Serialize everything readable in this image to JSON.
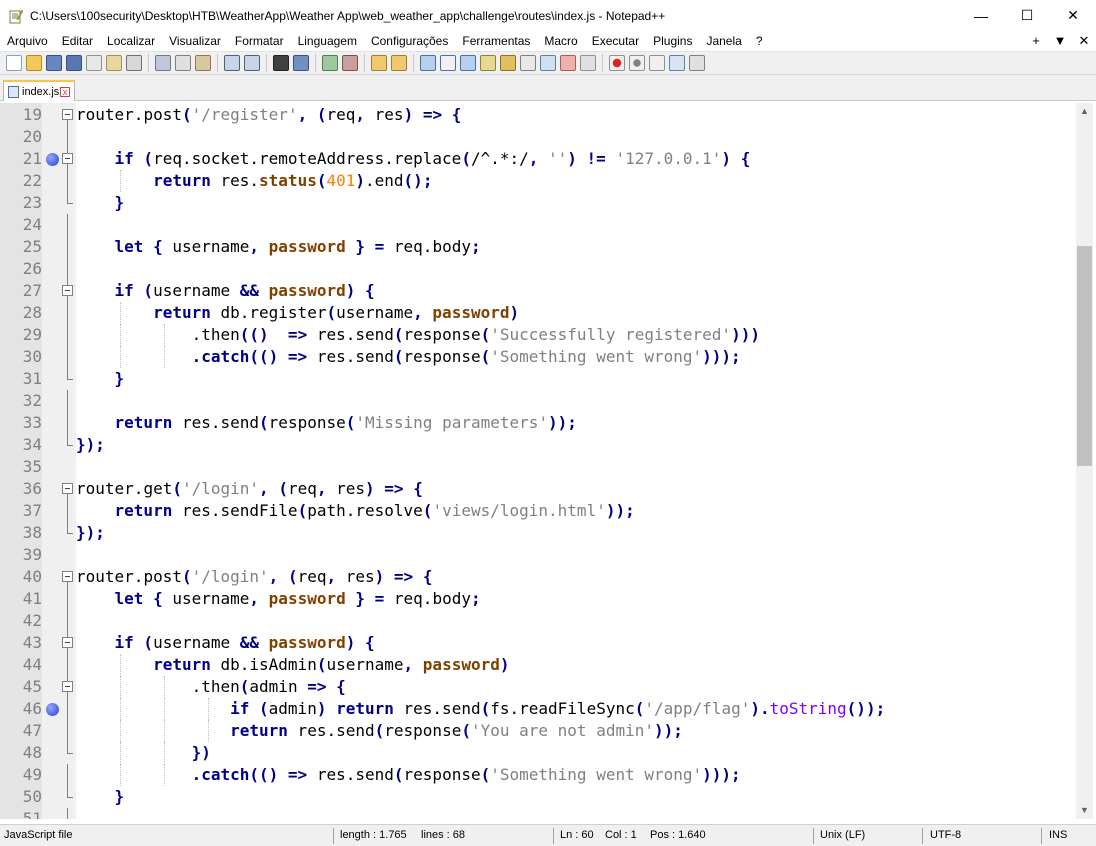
{
  "window": {
    "title": "C:\\Users\\100security\\Desktop\\HTB\\WeatherApp\\Weather App\\web_weather_app\\challenge\\routes\\index.js - Notepad++",
    "minimize_glyph": "—",
    "maximize_glyph": "☐",
    "close_glyph": "✕"
  },
  "menu": {
    "items": [
      "Arquivo",
      "Editar",
      "Localizar",
      "Visualizar",
      "Formatar",
      "Linguagem",
      "Configurações",
      "Ferramentas",
      "Macro",
      "Executar",
      "Plugins",
      "Janela",
      "?"
    ],
    "right": [
      "+",
      "▼",
      "✕"
    ]
  },
  "tab": {
    "label": "index.js"
  },
  "editor": {
    "lines": [
      {
        "n": "19",
        "fold": "start",
        "bookmark": false,
        "guides": [],
        "tokens": [
          [
            "txt",
            "router."
          ],
          [
            "txt",
            "post"
          ],
          [
            "op",
            "("
          ],
          [
            "str",
            "'/register'"
          ],
          [
            "op",
            ", ("
          ],
          [
            "txt",
            "req"
          ],
          [
            "op",
            ", "
          ],
          [
            "txt",
            "res"
          ],
          [
            "op",
            ") => {"
          ]
        ]
      },
      {
        "n": "20",
        "fold": "line",
        "bookmark": false,
        "guides": [],
        "tokens": []
      },
      {
        "n": "21",
        "fold": "start",
        "bookmark": true,
        "guides": [],
        "tokens": [
          [
            "txt",
            "    "
          ],
          [
            "kw",
            "if"
          ],
          [
            "op",
            " ("
          ],
          [
            "txt",
            "req.socket.remoteAddress.replace"
          ],
          [
            "op",
            "("
          ],
          [
            "txt",
            "/^.*:/"
          ],
          [
            "op",
            ", "
          ],
          [
            "str",
            "''"
          ],
          [
            "op",
            ") != "
          ],
          [
            "str",
            "'127.0.0.1'"
          ],
          [
            "op",
            ") {"
          ]
        ]
      },
      {
        "n": "22",
        "fold": "line",
        "bookmark": false,
        "guides": [
          1
        ],
        "tokens": [
          [
            "txt",
            "        "
          ],
          [
            "kw",
            "return"
          ],
          [
            "txt",
            " res."
          ],
          [
            "fn",
            "status"
          ],
          [
            "op",
            "("
          ],
          [
            "num",
            "401"
          ],
          [
            "op",
            ")"
          ],
          [
            "txt",
            ".end"
          ],
          [
            "op",
            "();"
          ]
        ]
      },
      {
        "n": "23",
        "fold": "end",
        "bookmark": false,
        "guides": [],
        "tokens": [
          [
            "txt",
            "    "
          ],
          [
            "op",
            "}"
          ]
        ]
      },
      {
        "n": "24",
        "fold": "line",
        "bookmark": false,
        "guides": [],
        "tokens": []
      },
      {
        "n": "25",
        "fold": "line",
        "bookmark": false,
        "guides": [],
        "tokens": [
          [
            "txt",
            "    "
          ],
          [
            "kw",
            "let"
          ],
          [
            "op",
            " { "
          ],
          [
            "txt",
            "username"
          ],
          [
            "op",
            ", "
          ],
          [
            "fn",
            "password"
          ],
          [
            "op",
            " } = "
          ],
          [
            "txt",
            "req.body"
          ],
          [
            "op",
            ";"
          ]
        ]
      },
      {
        "n": "26",
        "fold": "line",
        "bookmark": false,
        "guides": [],
        "tokens": []
      },
      {
        "n": "27",
        "fold": "start",
        "bookmark": false,
        "guides": [],
        "tokens": [
          [
            "txt",
            "    "
          ],
          [
            "kw",
            "if"
          ],
          [
            "op",
            " ("
          ],
          [
            "txt",
            "username "
          ],
          [
            "op",
            "&& "
          ],
          [
            "fn",
            "password"
          ],
          [
            "op",
            ") {"
          ]
        ]
      },
      {
        "n": "28",
        "fold": "line",
        "bookmark": false,
        "guides": [
          1
        ],
        "tokens": [
          [
            "txt",
            "        "
          ],
          [
            "kw",
            "return"
          ],
          [
            "txt",
            " db.register"
          ],
          [
            "op",
            "("
          ],
          [
            "txt",
            "username"
          ],
          [
            "op",
            ", "
          ],
          [
            "fn",
            "password"
          ],
          [
            "op",
            ")"
          ]
        ]
      },
      {
        "n": "29",
        "fold": "line",
        "bookmark": false,
        "guides": [
          1,
          2
        ],
        "tokens": [
          [
            "txt",
            "            "
          ],
          [
            "txt",
            ".then"
          ],
          [
            "op",
            "(()  => "
          ],
          [
            "txt",
            "res.send"
          ],
          [
            "op",
            "("
          ],
          [
            "txt",
            "response"
          ],
          [
            "op",
            "("
          ],
          [
            "str",
            "'Successfully registered'"
          ],
          [
            "op",
            ")))"
          ]
        ]
      },
      {
        "n": "30",
        "fold": "line",
        "bookmark": false,
        "guides": [
          1,
          2
        ],
        "tokens": [
          [
            "txt",
            "            "
          ],
          [
            "kw",
            ".catch"
          ],
          [
            "op",
            "(() => "
          ],
          [
            "txt",
            "res.send"
          ],
          [
            "op",
            "("
          ],
          [
            "txt",
            "response"
          ],
          [
            "op",
            "("
          ],
          [
            "str",
            "'Something went wrong'"
          ],
          [
            "op",
            ")));"
          ]
        ]
      },
      {
        "n": "31",
        "fold": "end",
        "bookmark": false,
        "guides": [],
        "tokens": [
          [
            "txt",
            "    "
          ],
          [
            "op",
            "}"
          ]
        ]
      },
      {
        "n": "32",
        "fold": "line",
        "bookmark": false,
        "guides": [],
        "tokens": []
      },
      {
        "n": "33",
        "fold": "line",
        "bookmark": false,
        "guides": [],
        "tokens": [
          [
            "txt",
            "    "
          ],
          [
            "kw",
            "return"
          ],
          [
            "txt",
            " res.send"
          ],
          [
            "op",
            "("
          ],
          [
            "txt",
            "response"
          ],
          [
            "op",
            "("
          ],
          [
            "str",
            "'Missing parameters'"
          ],
          [
            "op",
            "));"
          ]
        ]
      },
      {
        "n": "34",
        "fold": "end",
        "bookmark": false,
        "guides": [],
        "tokens": [
          [
            "op",
            "});"
          ]
        ]
      },
      {
        "n": "35",
        "fold": "none",
        "bookmark": false,
        "guides": [],
        "tokens": []
      },
      {
        "n": "36",
        "fold": "start",
        "bookmark": false,
        "guides": [],
        "tokens": [
          [
            "txt",
            "router."
          ],
          [
            "txt",
            "get"
          ],
          [
            "op",
            "("
          ],
          [
            "str",
            "'/login'"
          ],
          [
            "op",
            ", ("
          ],
          [
            "txt",
            "req"
          ],
          [
            "op",
            ", "
          ],
          [
            "txt",
            "res"
          ],
          [
            "op",
            ") => {"
          ]
        ]
      },
      {
        "n": "37",
        "fold": "line",
        "bookmark": false,
        "guides": [],
        "tokens": [
          [
            "txt",
            "    "
          ],
          [
            "kw",
            "return"
          ],
          [
            "txt",
            " res.sendFile"
          ],
          [
            "op",
            "("
          ],
          [
            "txt",
            "path.resolve"
          ],
          [
            "op",
            "("
          ],
          [
            "str",
            "'views/login.html'"
          ],
          [
            "op",
            "));"
          ]
        ]
      },
      {
        "n": "38",
        "fold": "end",
        "bookmark": false,
        "guides": [],
        "tokens": [
          [
            "op",
            "});"
          ]
        ]
      },
      {
        "n": "39",
        "fold": "none",
        "bookmark": false,
        "guides": [],
        "tokens": []
      },
      {
        "n": "40",
        "fold": "start",
        "bookmark": false,
        "guides": [],
        "tokens": [
          [
            "txt",
            "router."
          ],
          [
            "txt",
            "post"
          ],
          [
            "op",
            "("
          ],
          [
            "str",
            "'/login'"
          ],
          [
            "op",
            ", ("
          ],
          [
            "txt",
            "req"
          ],
          [
            "op",
            ", "
          ],
          [
            "txt",
            "res"
          ],
          [
            "op",
            ") => {"
          ]
        ]
      },
      {
        "n": "41",
        "fold": "line",
        "bookmark": false,
        "guides": [],
        "tokens": [
          [
            "txt",
            "    "
          ],
          [
            "kw",
            "let"
          ],
          [
            "op",
            " { "
          ],
          [
            "txt",
            "username"
          ],
          [
            "op",
            ", "
          ],
          [
            "fn",
            "password"
          ],
          [
            "op",
            " } = "
          ],
          [
            "txt",
            "req.body"
          ],
          [
            "op",
            ";"
          ]
        ]
      },
      {
        "n": "42",
        "fold": "line",
        "bookmark": false,
        "guides": [],
        "tokens": []
      },
      {
        "n": "43",
        "fold": "start",
        "bookmark": false,
        "guides": [],
        "tokens": [
          [
            "txt",
            "    "
          ],
          [
            "kw",
            "if"
          ],
          [
            "op",
            " ("
          ],
          [
            "txt",
            "username "
          ],
          [
            "op",
            "&& "
          ],
          [
            "fn",
            "password"
          ],
          [
            "op",
            ") {"
          ]
        ]
      },
      {
        "n": "44",
        "fold": "line",
        "bookmark": false,
        "guides": [
          1
        ],
        "tokens": [
          [
            "txt",
            "        "
          ],
          [
            "kw",
            "return"
          ],
          [
            "txt",
            " db.isAdmin"
          ],
          [
            "op",
            "("
          ],
          [
            "txt",
            "username"
          ],
          [
            "op",
            ", "
          ],
          [
            "fn",
            "password"
          ],
          [
            "op",
            ")"
          ]
        ]
      },
      {
        "n": "45",
        "fold": "start",
        "bookmark": false,
        "guides": [
          1,
          2
        ],
        "tokens": [
          [
            "txt",
            "            "
          ],
          [
            "txt",
            ".then"
          ],
          [
            "op",
            "("
          ],
          [
            "txt",
            "admin "
          ],
          [
            "op",
            "=> {"
          ]
        ]
      },
      {
        "n": "46",
        "fold": "line",
        "bookmark": true,
        "guides": [
          1,
          2,
          3
        ],
        "tokens": [
          [
            "txt",
            "                "
          ],
          [
            "kw",
            "if"
          ],
          [
            "op",
            " ("
          ],
          [
            "txt",
            "admin"
          ],
          [
            "op",
            ") "
          ],
          [
            "kw",
            "return"
          ],
          [
            "txt",
            " res.send"
          ],
          [
            "op",
            "("
          ],
          [
            "txt",
            "fs.readFileSync"
          ],
          [
            "op",
            "("
          ],
          [
            "str",
            "'/app/flag'"
          ],
          [
            "op",
            ")."
          ],
          [
            "purple",
            "toString"
          ],
          [
            "op",
            "());"
          ]
        ]
      },
      {
        "n": "47",
        "fold": "line",
        "bookmark": false,
        "guides": [
          1,
          2,
          3
        ],
        "tokens": [
          [
            "txt",
            "                "
          ],
          [
            "kw",
            "return"
          ],
          [
            "txt",
            " res.send"
          ],
          [
            "op",
            "("
          ],
          [
            "txt",
            "response"
          ],
          [
            "op",
            "("
          ],
          [
            "str",
            "'You are not admin'"
          ],
          [
            "op",
            "));"
          ]
        ]
      },
      {
        "n": "48",
        "fold": "end",
        "bookmark": false,
        "guides": [
          1,
          2
        ],
        "tokens": [
          [
            "txt",
            "            "
          ],
          [
            "op",
            "})"
          ]
        ]
      },
      {
        "n": "49",
        "fold": "line",
        "bookmark": false,
        "guides": [
          1,
          2
        ],
        "tokens": [
          [
            "txt",
            "            "
          ],
          [
            "kw",
            ".catch"
          ],
          [
            "op",
            "(() => "
          ],
          [
            "txt",
            "res.send"
          ],
          [
            "op",
            "("
          ],
          [
            "txt",
            "response"
          ],
          [
            "op",
            "("
          ],
          [
            "str",
            "'Something went wrong'"
          ],
          [
            "op",
            ")));"
          ]
        ]
      },
      {
        "n": "50",
        "fold": "end",
        "bookmark": false,
        "guides": [],
        "tokens": [
          [
            "txt",
            "    "
          ],
          [
            "op",
            "}"
          ]
        ]
      },
      {
        "n": "51",
        "fold": "line",
        "bookmark": false,
        "guides": [],
        "tokens": []
      }
    ]
  },
  "scrollbar": {
    "up": "▲",
    "down": "▼"
  },
  "status": {
    "file_type": "JavaScript file",
    "length": "length : 1.765",
    "lines": "lines : 68",
    "ln": "Ln : 60",
    "col": "Col : 1",
    "pos": "Pos : 1.640",
    "eol": "Unix (LF)",
    "encoding": "UTF-8",
    "mode": "INS"
  }
}
